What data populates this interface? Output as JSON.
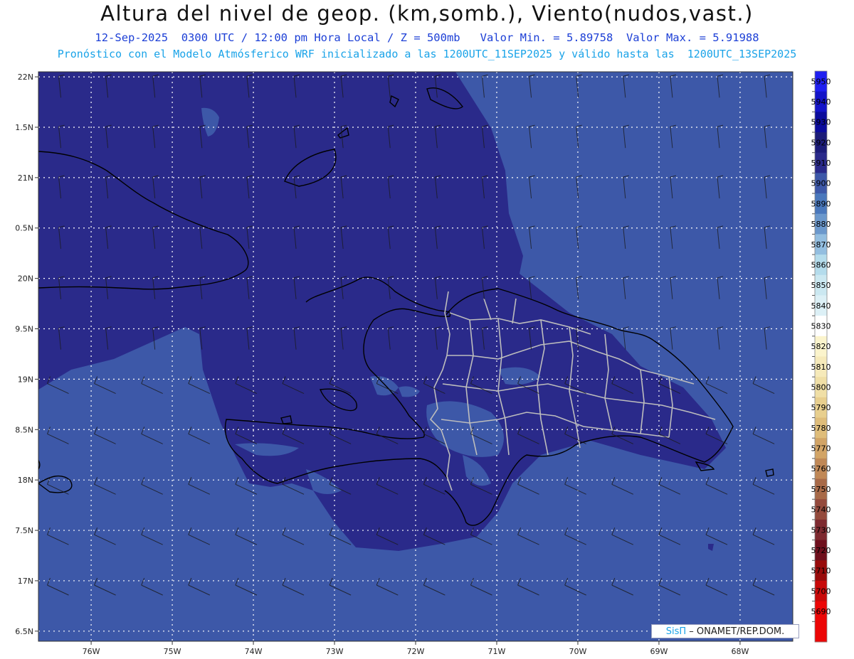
{
  "header": {
    "title": "Altura del nivel de geop. (km,somb.), Viento(nudos,vast.)",
    "subtitle_time": "12-Sep-2025  0300 UTC / 12:00 pm Hora Local / Z = 500mb",
    "subtitle_min": "Valor Min. = 5.89758",
    "subtitle_max": "Valor Max. = 5.91988",
    "subtitle_model": "Pronóstico con el Modelo Atmósferico WRF inicializado a las 1200UTC_11SEP2025 y válido hasta las  1200UTC_13SEP2025"
  },
  "map": {
    "lon_range": [
      -76.65,
      -67.35
    ],
    "lat_range": [
      16.4,
      22.05
    ],
    "lon_ticks": [
      {
        "value": -76,
        "label": "76W"
      },
      {
        "value": -75,
        "label": "75W"
      },
      {
        "value": -74,
        "label": "74W"
      },
      {
        "value": -73,
        "label": "73W"
      },
      {
        "value": -72,
        "label": "72W"
      },
      {
        "value": -71,
        "label": "71W"
      },
      {
        "value": -70,
        "label": "70W"
      },
      {
        "value": -69,
        "label": "69W"
      },
      {
        "value": -68,
        "label": "68W"
      }
    ],
    "lat_ticks": [
      {
        "value": 22,
        "label": "22N"
      },
      {
        "value": 21.5,
        "label": "1.5N"
      },
      {
        "value": 21,
        "label": "21N"
      },
      {
        "value": 20.5,
        "label": "0.5N"
      },
      {
        "value": 20,
        "label": "20N"
      },
      {
        "value": 19.5,
        "label": "9.5N"
      },
      {
        "value": 19,
        "label": "19N"
      },
      {
        "value": 18.5,
        "label": "8.5N"
      },
      {
        "value": 18,
        "label": "18N"
      },
      {
        "value": 17.5,
        "label": "7.5N"
      },
      {
        "value": 17,
        "label": "17N"
      },
      {
        "value": 16.5,
        "label": "6.5N"
      }
    ],
    "colors": {
      "field_5910": "#2a2a8a",
      "field_5900": "#3d58a8",
      "coast": "#000000",
      "borders": "#bdbdbd",
      "grid": "#ffffff"
    },
    "grid": true
  },
  "colorbar": {
    "levels": [
      5950,
      5940,
      5930,
      5920,
      5910,
      5900,
      5890,
      5880,
      5870,
      5860,
      5850,
      5840,
      5830,
      5820,
      5810,
      5800,
      5790,
      5780,
      5770,
      5760,
      5750,
      5740,
      5730,
      5720,
      5710,
      5700,
      5690
    ],
    "colors": [
      "#1f1ff0",
      "#1414c8",
      "#0c0c9c",
      "#1c1c78",
      "#2a2a8a",
      "#3d58a8",
      "#4a78bc",
      "#6b98cc",
      "#93bee0",
      "#b4dcec",
      "#cbe8f1",
      "#dcf0f6",
      "#ffffff",
      "#fbf4cc",
      "#f6eaba",
      "#f0dfa6",
      "#e8cf8e",
      "#dfbd7a",
      "#d2a466",
      "#c08856",
      "#a86a48",
      "#944a3c",
      "#7e2a30",
      "#6e0f1c",
      "#980a0a",
      "#c80808",
      "#ec0606"
    ]
  },
  "credit": {
    "logo": "SisΠ",
    "text": " – ONAMET/REP.DOM."
  }
}
